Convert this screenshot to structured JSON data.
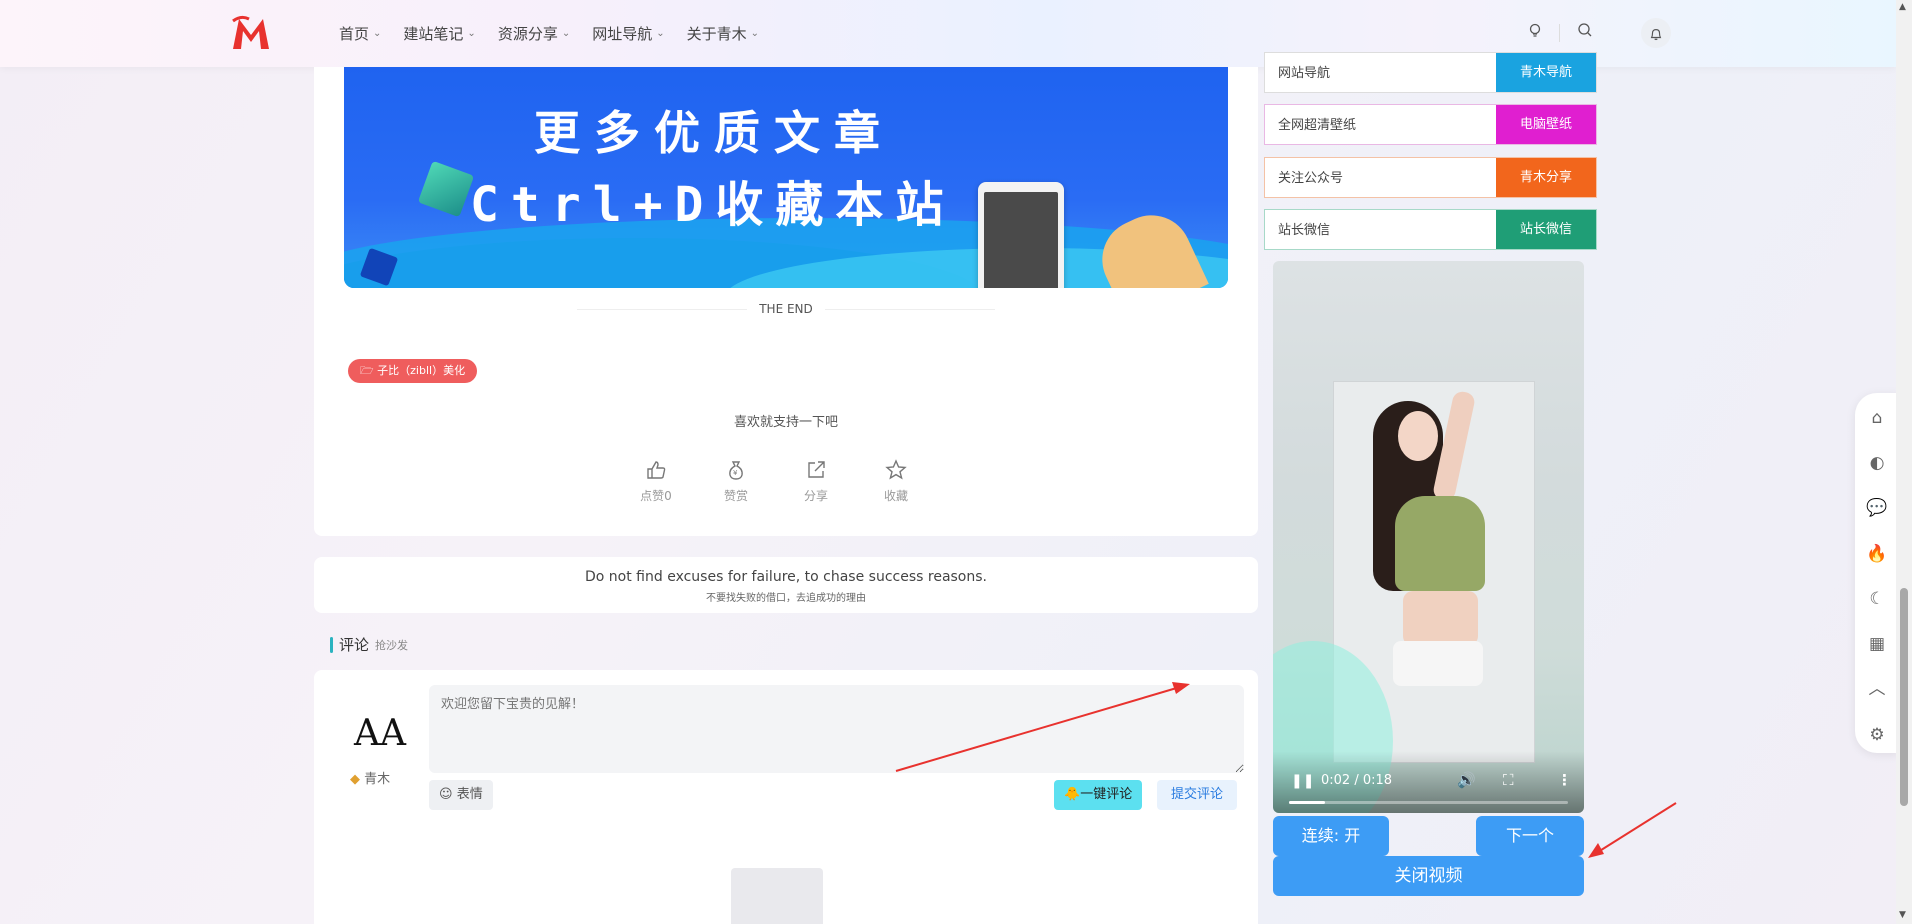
{
  "header": {
    "nav": [
      {
        "label": "首页"
      },
      {
        "label": "建站笔记"
      },
      {
        "label": "资源分享"
      },
      {
        "label": "网址导航"
      },
      {
        "label": "关于青木"
      }
    ],
    "icons": [
      "theme-icon",
      "search-icon",
      "bell-icon"
    ]
  },
  "article": {
    "banner_line1": "更多优质文章",
    "banner_line2": "Ctrl+D收藏本站",
    "the_end": "THE END",
    "tag": "子比（zibll）美化",
    "support_text": "喜欢就支持一下吧",
    "actions": [
      {
        "label": "点赞0",
        "icon": "thumbs-up-icon"
      },
      {
        "label": "赞赏",
        "icon": "money-bag-icon"
      },
      {
        "label": "分享",
        "icon": "share-icon"
      },
      {
        "label": "收藏",
        "icon": "star-icon"
      }
    ]
  },
  "quote": {
    "en": "Do not find excuses for failure, to chase success reasons.",
    "cn": "不要找失败的借口，去追成功的理由"
  },
  "comments": {
    "title": "评论",
    "subtitle": "抢沙发",
    "avatar_text": "AA",
    "username": "青木",
    "placeholder": "欢迎您留下宝贵的见解！",
    "emoji_label": "表情",
    "quick_label": "一键评论",
    "submit_label": "提交评论"
  },
  "sidebar_links": [
    {
      "label": "网站导航",
      "button": "青木导航",
      "color": "#1aa3e0"
    },
    {
      "label": "全网超清壁纸",
      "button": "电脑壁纸",
      "color": "#e01fd0"
    },
    {
      "label": "关注公众号",
      "button": "青木分享",
      "color": "#f2661c"
    },
    {
      "label": "站长微信",
      "button": "站长微信",
      "color": "#1f9e76"
    }
  ],
  "video": {
    "time": "0:02 / 0:18",
    "progress": 0.13,
    "continuous_label": "连续: 开",
    "next_label": "下一个",
    "close_label": "关闭视频"
  },
  "float_toolbar": [
    "home-icon",
    "browser-icon",
    "chat-icon",
    "fire-icon",
    "moon-icon",
    "qrcode-icon",
    "chevron-up-icon",
    "gear-icon"
  ],
  "colors": {
    "accent_blue": "#3d9cf5",
    "tag_red": "#ef5d5d",
    "quick_cyan": "#5ce0f0",
    "arrow_red": "#e8322e"
  }
}
